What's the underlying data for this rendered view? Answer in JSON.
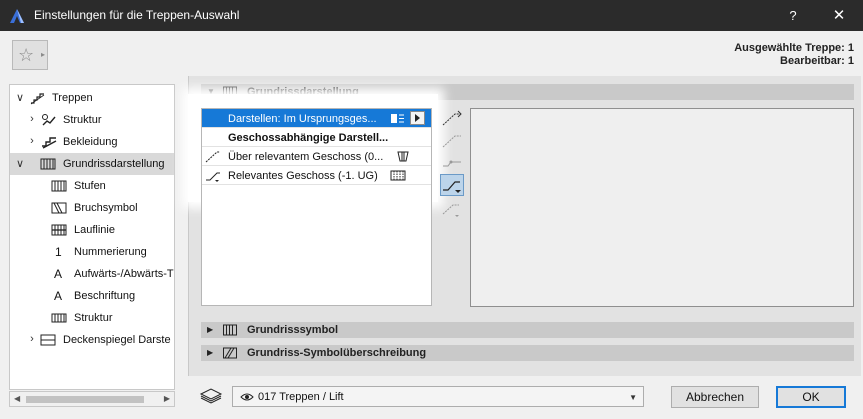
{
  "window": {
    "title": "Einstellungen für die Treppen-Auswahl",
    "help_label": "?",
    "close_label": "✕"
  },
  "selection_info": {
    "line1": "Ausgewählte Treppe: 1",
    "line2": "Bearbeitbar: 1"
  },
  "tree": {
    "items": [
      {
        "label": "Treppen",
        "expander": "∨",
        "icon": "stair-icon"
      },
      {
        "label": "Struktur",
        "expander": "›",
        "icon": "structure-icon"
      },
      {
        "label": "Bekleidung",
        "expander": "›",
        "icon": "cladding-icon"
      },
      {
        "label": "Grundrissdarstellung",
        "expander": "∨",
        "icon": "floorplan-icon"
      },
      {
        "label": "Stufen",
        "icon": "treads-icon"
      },
      {
        "label": "Bruchsymbol",
        "icon": "break-mark-icon"
      },
      {
        "label": "Lauflinie",
        "icon": "walking-line-icon"
      },
      {
        "label": "Nummerierung",
        "icon": "numbering-icon",
        "glyph": "1"
      },
      {
        "label": "Aufwärts-/Abwärts-T",
        "icon": "updown-text-icon",
        "glyph": "A"
      },
      {
        "label": "Beschriftung",
        "icon": "label-icon",
        "glyph": "A"
      },
      {
        "label": "Struktur",
        "icon": "structure-plan-icon"
      },
      {
        "label": "Deckenspiegel Darste",
        "expander": "›",
        "icon": "ceiling-plan-icon"
      }
    ]
  },
  "sections": {
    "floorplan": {
      "label": "Grundrissdarstellung",
      "toggle": "▼"
    },
    "symbol": {
      "label": "Grundrisssymbol",
      "toggle": "▶"
    },
    "symbol_override": {
      "label": "Grundriss-Symbolüberschreibung",
      "toggle": "▶"
    }
  },
  "list": {
    "rows": [
      {
        "label": "Darstellen: Im Ursprungsges...",
        "active": true
      },
      {
        "label": "Geschossabhängige Darstell...",
        "bold": true
      },
      {
        "label": "Über relevantem Geschoss (0...",
        "icon": "above-story-icon"
      },
      {
        "label": "Relevantes Geschoss (-1. UG)",
        "icon": "relevant-story-icon"
      }
    ]
  },
  "footer": {
    "layer": "017 Treppen / Lift",
    "cancel_label": "Abbrechen",
    "ok_label": "OK"
  },
  "colors": {
    "titlebar": "#2b2b2b",
    "selection_blue": "#1679d7",
    "section_header": "#c9c9c9"
  }
}
